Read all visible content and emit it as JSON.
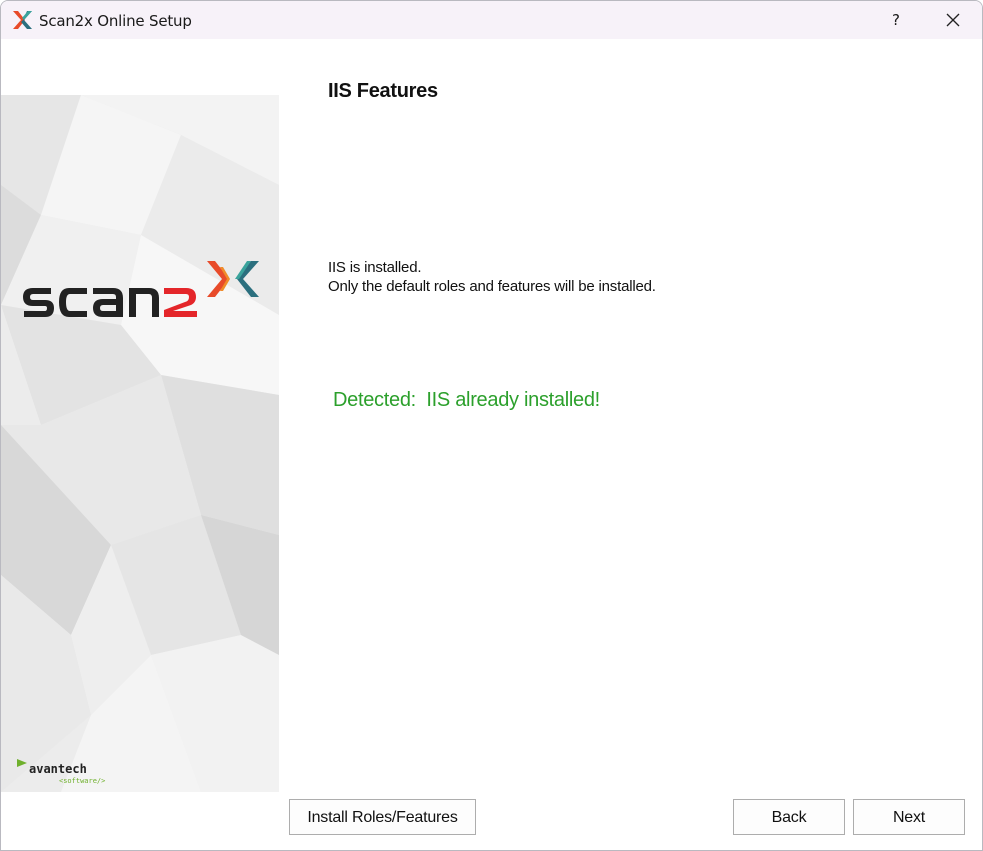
{
  "window": {
    "title": "Scan2x Online Setup",
    "help_label": "?",
    "close_icon": "close-icon"
  },
  "side_panel": {
    "logo_icon": "scan2x-logo",
    "vendor_logo_text": "avantech",
    "vendor_logo_subtext": "<software/>"
  },
  "content": {
    "heading": "IIS Features",
    "info_line_1": "IIS is installed.",
    "info_line_2": "Only the default roles and features will be installed.",
    "status": "Detected:  IIS already installed!",
    "status_color": "#2ca02c"
  },
  "buttons": {
    "install_label": "Install Roles/Features",
    "back_label": "Back",
    "next_label": "Next"
  }
}
